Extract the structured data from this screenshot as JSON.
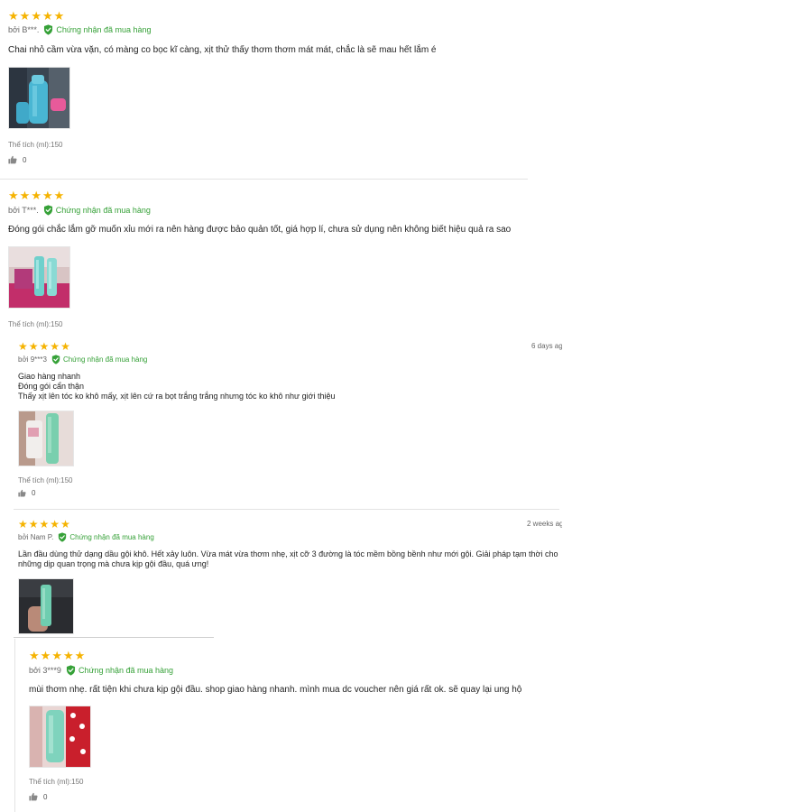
{
  "colors": {
    "star": "#f5b301",
    "verified": "#36a138",
    "divider": "#e3e3e3"
  },
  "reviews": [
    {
      "rating": 5,
      "author": "bởi B***.",
      "verified_label": "Chứng nhận đã mua hàng",
      "text": "Chai nhỏ cầm vừa vặn, có màng co bọc kĩ càng, xịt thử thấy thơm thơm mát mát, chắc là sẽ mau hết lắm é",
      "attribute": "Thể tích (ml):150",
      "likes": "0",
      "photo_icon": "review-photo-blue-spray-bottle"
    },
    {
      "rating": 5,
      "author": "bởi T***.",
      "verified_label": "Chứng nhận đã mua hàng",
      "text": "Đóng gói chắc lắm gỡ muốn xỉu mới ra nên hàng được bảo quản tốt, giá hợp lí, chưa sử dụng nên không biết hiệu quả ra sao",
      "attribute": "Thể tích (ml):150",
      "likes": "",
      "photo_icon": "review-photo-bottles-with-package"
    },
    {
      "rating": 5,
      "author": "bởi 9***3",
      "verified_label": "Chứng nhận đã mua hàng",
      "date": "6 days ag",
      "text": "Giao hàng nhanh\nĐóng gói cẩn thận\nThấy xịt lên tóc ko khô mấy, xịt lên cứ ra bọt trắng trắng nhưng tóc ko khô như giới thiệu",
      "attribute": "Thể tích (ml):150",
      "likes": "0",
      "photo_icon": "review-photo-teal-spray-bottle"
    },
    {
      "rating": 5,
      "author": "bởi Nam P.",
      "verified_label": "Chứng nhận đã mua hàng",
      "date": "2 weeks ag",
      "text": "Lần đầu dùng thử dạng dầu gội khô. Hết xảy luôn. Vừa mát vừa thơm nhẹ, xịt cỡ 3 đường là tóc mềm bồng bềnh như mới gội. Giải pháp tạm thời cho những dịp quan trọng mà chưa kịp gội đầu, quá ưng!",
      "photo_icon": "review-photo-hand-holding-bottle"
    },
    {
      "rating": 5,
      "author": "bởi 3***9",
      "verified_label": "Chứng nhận đã mua hàng",
      "text": "mùi thơm nhẹ. rất tiện khi chưa kịp gội đầu. shop giao hàng nhanh. mình mua dc voucher nên giá rất ok. sẽ quay lại ung hộ",
      "attribute": "Thể tích (ml):150",
      "likes": "0",
      "photo_icon": "review-photo-bottle-on-polka-dots"
    }
  ]
}
